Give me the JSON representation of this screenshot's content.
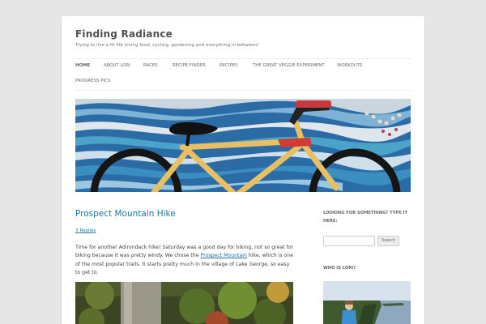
{
  "site": {
    "title": "Finding Radiance",
    "description": "Trying to live a fit life loving food, cycling, gardening and everything in-between!"
  },
  "nav": {
    "items": [
      {
        "label": "HOME",
        "current": true
      },
      {
        "label": "ABOUT LORI"
      },
      {
        "label": "RACES"
      },
      {
        "label": "RECIPE FINDER"
      },
      {
        "label": "RECIPES"
      },
      {
        "label": "THE GREAT VEGGIE EXPERIMENT"
      },
      {
        "label": "WORKOUTS"
      },
      {
        "label": "PROGRESS PICS"
      }
    ]
  },
  "post": {
    "title": "Prospect Mountain Hike",
    "replies": "3 Replies",
    "text_before_link": "Time for another Adirondack hike! Saturday was a good day for hiking, not so great for biking because it was pretty windy.  We chose the ",
    "link_text": "Prospect Mountain",
    "text_after_link": " hike, which is one of the most popular trails. It starts pretty much in the village of Lake George, so easy to get to."
  },
  "sidebar": {
    "search_title": "LOOKING FOR SOMETHING? TYPE IT HERE:",
    "search_placeholder": "",
    "search_button": "Search",
    "who_title": "WHO IS LORI?"
  },
  "colors": {
    "link": "#21759b",
    "background": "#e6e6e6",
    "page": "#ffffff"
  }
}
